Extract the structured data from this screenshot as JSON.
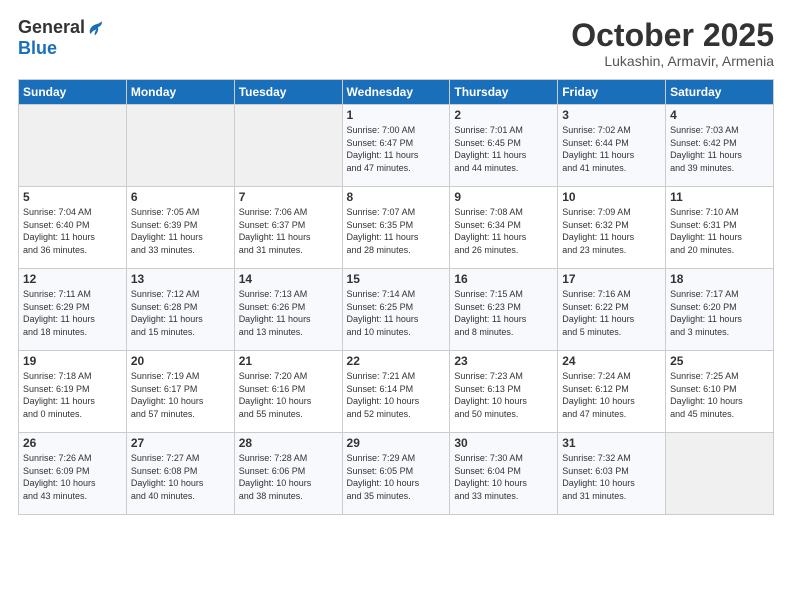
{
  "header": {
    "logo_general": "General",
    "logo_blue": "Blue",
    "month_title": "October 2025",
    "location": "Lukashin, Armavir, Armenia"
  },
  "days_of_week": [
    "Sunday",
    "Monday",
    "Tuesday",
    "Wednesday",
    "Thursday",
    "Friday",
    "Saturday"
  ],
  "weeks": [
    [
      {
        "num": "",
        "info": ""
      },
      {
        "num": "",
        "info": ""
      },
      {
        "num": "",
        "info": ""
      },
      {
        "num": "1",
        "info": "Sunrise: 7:00 AM\nSunset: 6:47 PM\nDaylight: 11 hours\nand 47 minutes."
      },
      {
        "num": "2",
        "info": "Sunrise: 7:01 AM\nSunset: 6:45 PM\nDaylight: 11 hours\nand 44 minutes."
      },
      {
        "num": "3",
        "info": "Sunrise: 7:02 AM\nSunset: 6:44 PM\nDaylight: 11 hours\nand 41 minutes."
      },
      {
        "num": "4",
        "info": "Sunrise: 7:03 AM\nSunset: 6:42 PM\nDaylight: 11 hours\nand 39 minutes."
      }
    ],
    [
      {
        "num": "5",
        "info": "Sunrise: 7:04 AM\nSunset: 6:40 PM\nDaylight: 11 hours\nand 36 minutes."
      },
      {
        "num": "6",
        "info": "Sunrise: 7:05 AM\nSunset: 6:39 PM\nDaylight: 11 hours\nand 33 minutes."
      },
      {
        "num": "7",
        "info": "Sunrise: 7:06 AM\nSunset: 6:37 PM\nDaylight: 11 hours\nand 31 minutes."
      },
      {
        "num": "8",
        "info": "Sunrise: 7:07 AM\nSunset: 6:35 PM\nDaylight: 11 hours\nand 28 minutes."
      },
      {
        "num": "9",
        "info": "Sunrise: 7:08 AM\nSunset: 6:34 PM\nDaylight: 11 hours\nand 26 minutes."
      },
      {
        "num": "10",
        "info": "Sunrise: 7:09 AM\nSunset: 6:32 PM\nDaylight: 11 hours\nand 23 minutes."
      },
      {
        "num": "11",
        "info": "Sunrise: 7:10 AM\nSunset: 6:31 PM\nDaylight: 11 hours\nand 20 minutes."
      }
    ],
    [
      {
        "num": "12",
        "info": "Sunrise: 7:11 AM\nSunset: 6:29 PM\nDaylight: 11 hours\nand 18 minutes."
      },
      {
        "num": "13",
        "info": "Sunrise: 7:12 AM\nSunset: 6:28 PM\nDaylight: 11 hours\nand 15 minutes."
      },
      {
        "num": "14",
        "info": "Sunrise: 7:13 AM\nSunset: 6:26 PM\nDaylight: 11 hours\nand 13 minutes."
      },
      {
        "num": "15",
        "info": "Sunrise: 7:14 AM\nSunset: 6:25 PM\nDaylight: 11 hours\nand 10 minutes."
      },
      {
        "num": "16",
        "info": "Sunrise: 7:15 AM\nSunset: 6:23 PM\nDaylight: 11 hours\nand 8 minutes."
      },
      {
        "num": "17",
        "info": "Sunrise: 7:16 AM\nSunset: 6:22 PM\nDaylight: 11 hours\nand 5 minutes."
      },
      {
        "num": "18",
        "info": "Sunrise: 7:17 AM\nSunset: 6:20 PM\nDaylight: 11 hours\nand 3 minutes."
      }
    ],
    [
      {
        "num": "19",
        "info": "Sunrise: 7:18 AM\nSunset: 6:19 PM\nDaylight: 11 hours\nand 0 minutes."
      },
      {
        "num": "20",
        "info": "Sunrise: 7:19 AM\nSunset: 6:17 PM\nDaylight: 10 hours\nand 57 minutes."
      },
      {
        "num": "21",
        "info": "Sunrise: 7:20 AM\nSunset: 6:16 PM\nDaylight: 10 hours\nand 55 minutes."
      },
      {
        "num": "22",
        "info": "Sunrise: 7:21 AM\nSunset: 6:14 PM\nDaylight: 10 hours\nand 52 minutes."
      },
      {
        "num": "23",
        "info": "Sunrise: 7:23 AM\nSunset: 6:13 PM\nDaylight: 10 hours\nand 50 minutes."
      },
      {
        "num": "24",
        "info": "Sunrise: 7:24 AM\nSunset: 6:12 PM\nDaylight: 10 hours\nand 47 minutes."
      },
      {
        "num": "25",
        "info": "Sunrise: 7:25 AM\nSunset: 6:10 PM\nDaylight: 10 hours\nand 45 minutes."
      }
    ],
    [
      {
        "num": "26",
        "info": "Sunrise: 7:26 AM\nSunset: 6:09 PM\nDaylight: 10 hours\nand 43 minutes."
      },
      {
        "num": "27",
        "info": "Sunrise: 7:27 AM\nSunset: 6:08 PM\nDaylight: 10 hours\nand 40 minutes."
      },
      {
        "num": "28",
        "info": "Sunrise: 7:28 AM\nSunset: 6:06 PM\nDaylight: 10 hours\nand 38 minutes."
      },
      {
        "num": "29",
        "info": "Sunrise: 7:29 AM\nSunset: 6:05 PM\nDaylight: 10 hours\nand 35 minutes."
      },
      {
        "num": "30",
        "info": "Sunrise: 7:30 AM\nSunset: 6:04 PM\nDaylight: 10 hours\nand 33 minutes."
      },
      {
        "num": "31",
        "info": "Sunrise: 7:32 AM\nSunset: 6:03 PM\nDaylight: 10 hours\nand 31 minutes."
      },
      {
        "num": "",
        "info": ""
      }
    ]
  ]
}
